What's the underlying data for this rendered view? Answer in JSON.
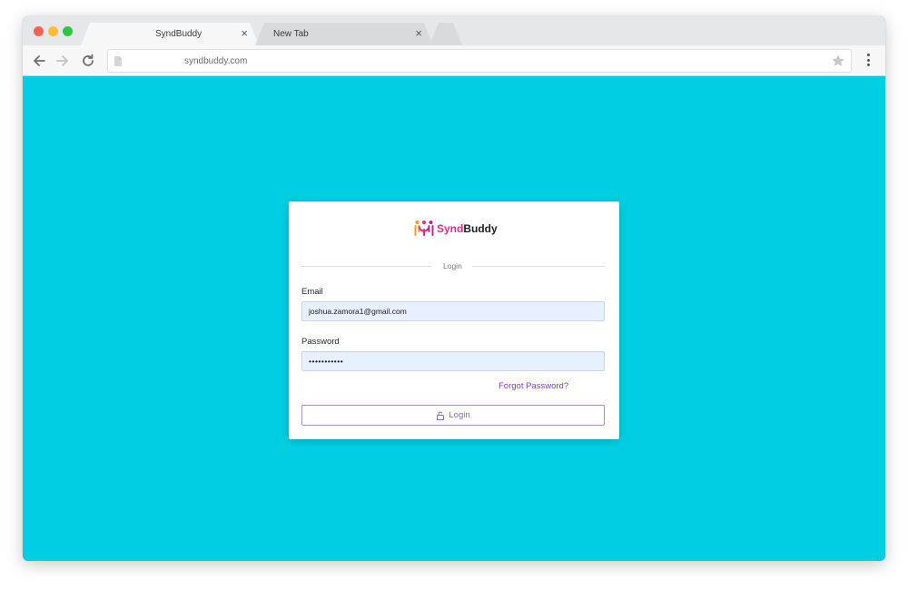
{
  "browser": {
    "tabs": [
      {
        "title": "SyndBuddy",
        "close": "×",
        "active": true
      },
      {
        "title": "New Tab",
        "close": "×",
        "active": false
      }
    ],
    "url": "syndbuddy.com",
    "icons": [
      "back-arrow-icon",
      "forward-arrow-icon",
      "reload-icon",
      "page-icon",
      "star-icon",
      "menu-dots-icon"
    ]
  },
  "login": {
    "logo": {
      "part1": "Synd",
      "part2": "Buddy"
    },
    "heading": "Login",
    "email_label": "Email",
    "email_value": "joshua.zamora1@gmail.com",
    "password_label": "Password",
    "password_value": "•••••••••••",
    "forgot_label": "Forgot Password?",
    "button_label": "Login"
  },
  "colors": {
    "page_background": "#00cfe3",
    "card": "#ffffff",
    "input_fill": "#e7f0fe",
    "accent": "#7c3aed",
    "logo_pink": "#e8298a",
    "logo_orange": "#f39c1f"
  }
}
